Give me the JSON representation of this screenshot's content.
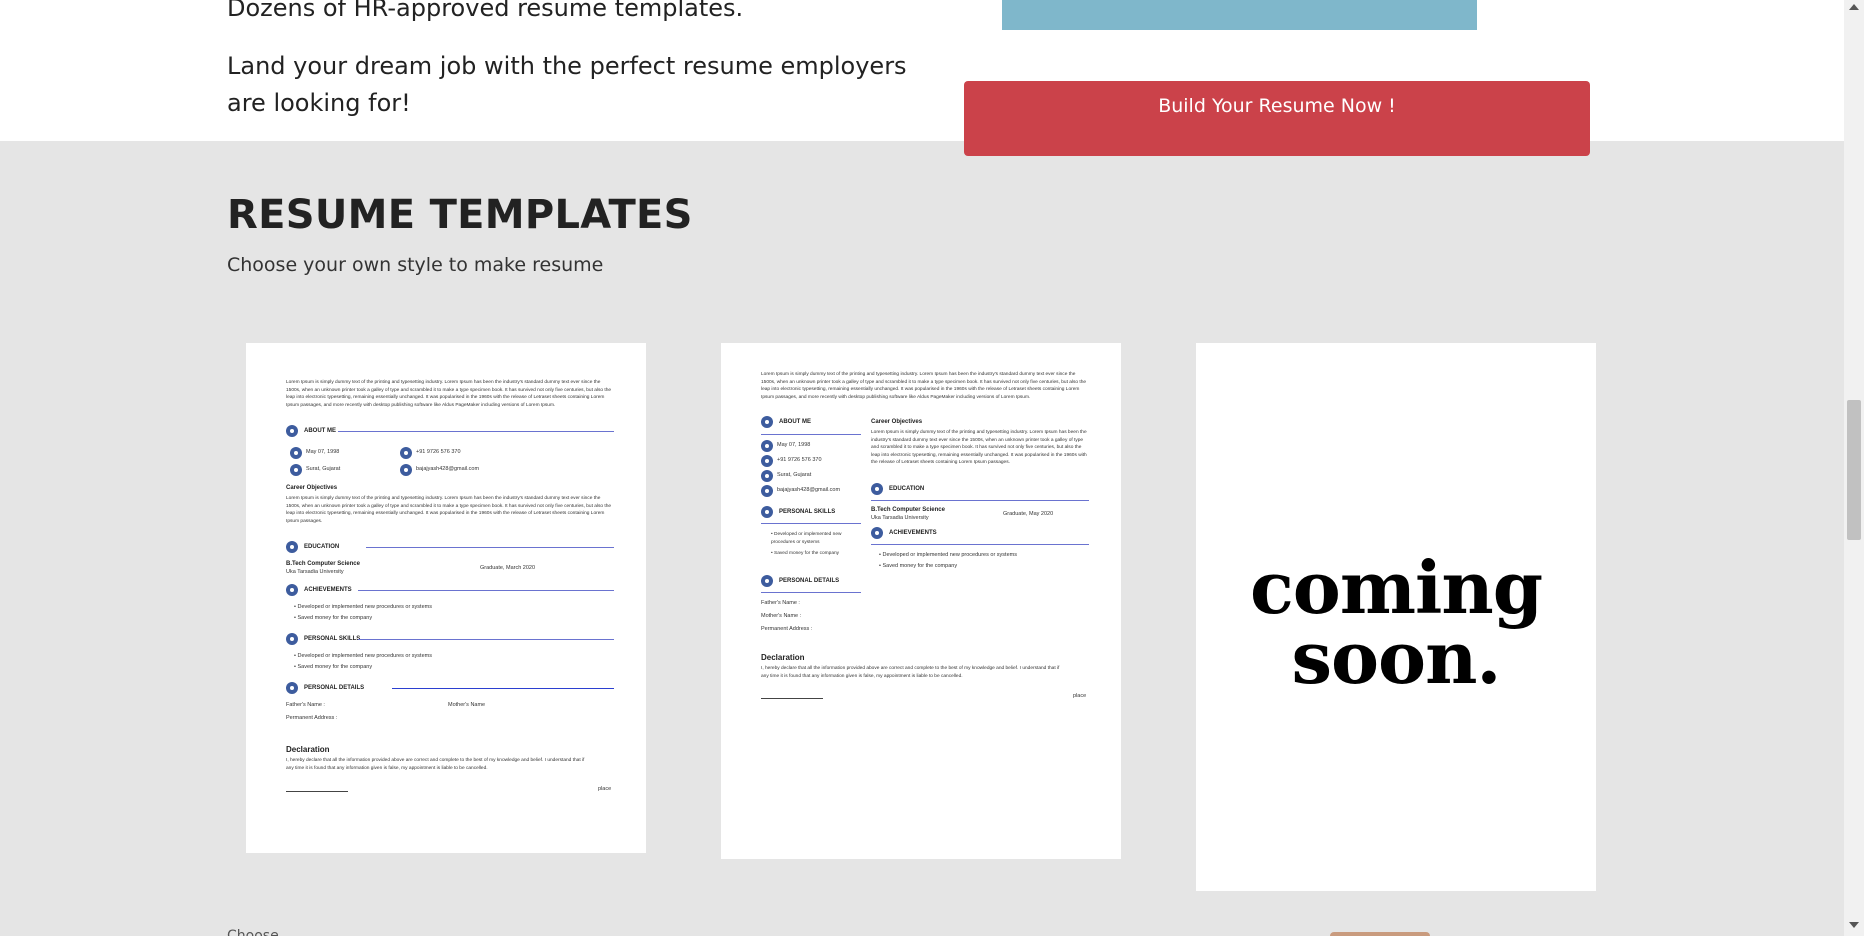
{
  "hero": {
    "line1": "Dozens of HR-approved resume templates.",
    "line2": "Land your dream job with the perfect resume employers are looking for!",
    "cta_label": "Build Your Resume Now !"
  },
  "templates_section": {
    "title": "RESUME TEMPLATES",
    "subtitle": "Choose your own style to make resume"
  },
  "template1": {
    "intro": "Lorem Ipsum is simply dummy text of the printing and typesetting industry. Lorem Ipsum has been the industry's standard dummy text ever since the 1500s, when an unknown printer took a galley of type and scrambled it to make a type specimen book. It has survived not only five centuries, but also the leap into electronic typesetting, remaining essentially unchanged. It was popularised in the 1960s with the release of Letraset sheets containing Lorem Ipsum passages, and more recently with desktop publishing software like Aldus PageMaker including versions of Lorem Ipsum.",
    "about_me": "ABOUT ME",
    "dob": "May 07, 1998",
    "phone": "+91 9726 576 370",
    "location": "Surat, Gujarat",
    "email": "bajajyash428@gmail.com",
    "career_heading": "Career Objectives",
    "career_text": "Lorem Ipsum is simply dummy text of the printing and typesetting industry. Lorem Ipsum has been the industry's standard dummy text ever since the 1500s, when an unknown printer took a galley of type and scrambled it to make a type specimen book. It has survived not only five centuries, but also the leap into electronic typesetting, remaining essentially unchanged. It was popularised in the 1960s with the release of Letraset sheets containing Lorem Ipsum passages.",
    "education": "EDUCATION",
    "degree": "B.Tech Computer Science",
    "university": "Uka Tarsadia University",
    "graduated": "Graduate, March 2020",
    "achievements": "ACHIEVEMENTS",
    "ach1": "Developed or implemented new procedures or systems",
    "ach2": "Saved money for the company",
    "skills": "PERSONAL SKILLS",
    "skill1": "Developed or implemented new procedures or systems",
    "skill2": "Saved money for the company",
    "details": "PERSONAL DETAILS",
    "father": "Father's Name :",
    "mother": "Mother's Name",
    "address": "Permanent Address :",
    "declaration": "Declaration",
    "declaration_text": "I, hereby declare that all the information provided above are correct and complete to the best of my knowledge and belief. I understand that if any time it is found that any information given is false, my appointment is liable to be cancelled.",
    "place": "place"
  },
  "template2": {
    "intro": "Lorem Ipsum is simply dummy text of the printing and typesetting industry. Lorem Ipsum has been the industry's standard dummy text ever since the 1500s, when an unknown printer took a galley of type and scrambled it to make a type specimen book. It has survived not only five centuries, but also the leap into electronic typesetting, remaining essentially unchanged. It was popularised in the 1960s with the release of Letraset sheets containing Lorem Ipsum passages, and more recently with desktop publishing software like Aldus PageMaker including versions of Lorem Ipsum.",
    "about_me": "ABOUT ME",
    "dob": "May 07, 1998",
    "phone": "+91 9726 576 370",
    "location": "Surat, Gujarat",
    "email": "bajajyash428@gmail.com",
    "skills": "PERSONAL SKILLS",
    "skill1": "Developed or implemented new procedures or systems",
    "skill2": "Saved money for the company",
    "details": "PERSONAL DETAILS",
    "father": "Father's Name :",
    "mother": "Mother's Name :",
    "address": "Permanent Address :",
    "career_heading": "Career Objectives",
    "career_text": "Lorem Ipsum is simply dummy text of the printing and typesetting industry. Lorem Ipsum has been the industry's standard dummy text ever since the 1500s, when an unknown printer took a galley of type and scrambled it to make a type specimen book. It has survived not only five centuries, but also the leap into electronic typesetting, remaining essentially unchanged. It was popularised in the 1960s with the release of Letraset sheets containing Lorem Ipsum passages.",
    "education": "EDUCATION",
    "degree": "B.Tech Computer Science",
    "university": "Uka Tarsadia University",
    "graduated": "Graduate, May 2020",
    "achievements": "ACHIEVEMENTS",
    "ach1": "Developed or implemented new procedures or systems",
    "ach2": "Saved money for the company",
    "declaration": "Declaration",
    "declaration_text": "I, hereby declare that all the information provided above are correct and complete to the best of my knowledge and belief. I understand that if any time it is found that any information given is false, my appointment is liable to be cancelled.",
    "place": "place"
  },
  "template3": {
    "label": "coming soon."
  },
  "bottom_peek": "Choose ...",
  "colors": {
    "cta": "#cb424a",
    "hero_image": "#7fb7cb",
    "section_bg": "#e5e5e5",
    "resume_rule": "#6a73d0",
    "resume_icon": "#3d5c9e"
  }
}
